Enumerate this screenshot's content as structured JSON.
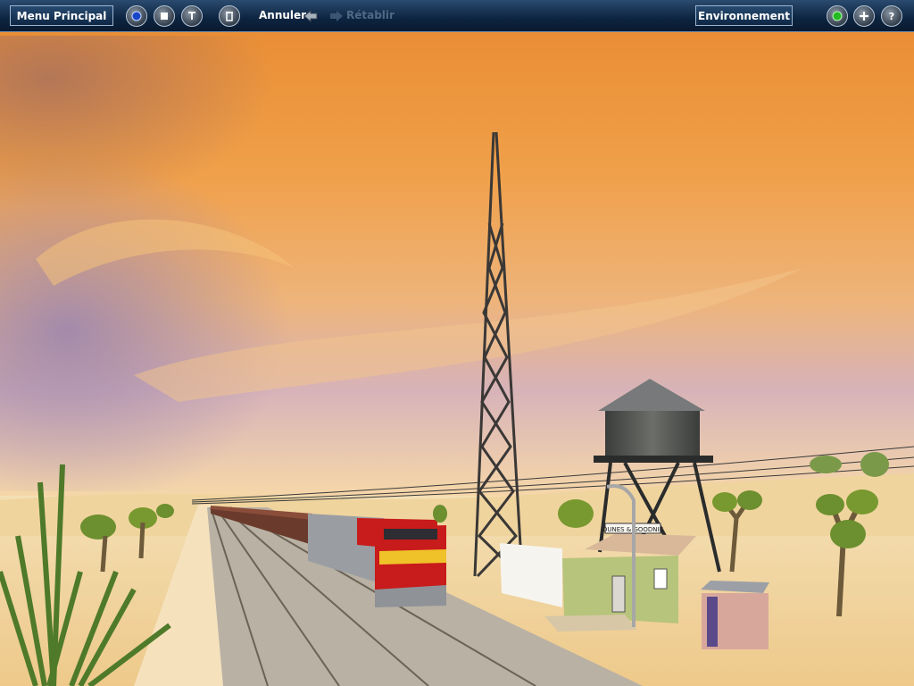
{
  "toolbar": {
    "main_menu_label": "Menu Principal",
    "undo_label": "Annuler",
    "redo_label": "Rétablir",
    "environment_label": "Environnement"
  },
  "scene": {
    "station_sign": "DUNES & GOODNIE"
  },
  "colors": {
    "toolbar_bg": "#0d2440",
    "sky_top": "#e78a2f",
    "sky_low": "#c89ac8",
    "sand": "#f2d49c",
    "locomotive_red": "#c81b1b",
    "locomotive_yellow": "#f0c22a",
    "status_green": "#22bb22"
  },
  "icons": {
    "left_group": [
      "globe-icon",
      "stop-icon",
      "wrench-icon",
      "trash-icon"
    ],
    "undo": "arrow-left-icon",
    "redo": "arrow-right-icon",
    "right_group": [
      "status-light-icon",
      "add-icon",
      "help-icon"
    ]
  }
}
